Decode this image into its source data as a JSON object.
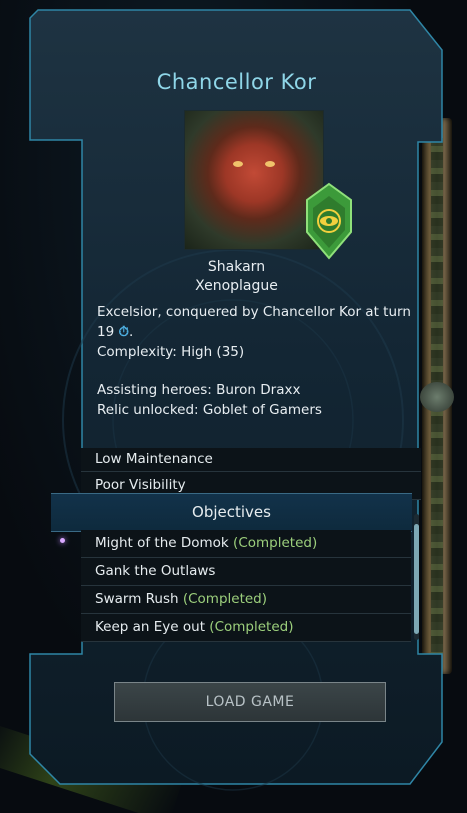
{
  "hero": {
    "title": "Chancellor Kor",
    "race": "Shakarn",
    "faction": "Xenoplague"
  },
  "details": {
    "line1a": "Excelsior, conquered by Chancellor Kor at turn",
    "turn": "19",
    "line1b": ".",
    "complexity": "Complexity: High (35)",
    "assisting": "Assisting heroes: Buron Draxx",
    "relic": "Relic unlocked: Goblet of Gamers"
  },
  "traits": [
    {
      "label": "Low Maintenance"
    },
    {
      "label": "Poor Visibility"
    }
  ],
  "objectives": {
    "header": "Objectives",
    "items": [
      {
        "label": "Might of the Domok",
        "status": "(Completed)"
      },
      {
        "label": "Gank the Outlaws",
        "status": ""
      },
      {
        "label": "Swarm Rush",
        "status": "(Completed)"
      },
      {
        "label": "Keep an Eye out",
        "status": "(Completed)"
      }
    ]
  },
  "actions": {
    "load_game": "LOAD GAME"
  },
  "colors": {
    "accent": "#8fd6e8",
    "completed": "#9ccf7c",
    "badge": "#3c9a3a"
  }
}
